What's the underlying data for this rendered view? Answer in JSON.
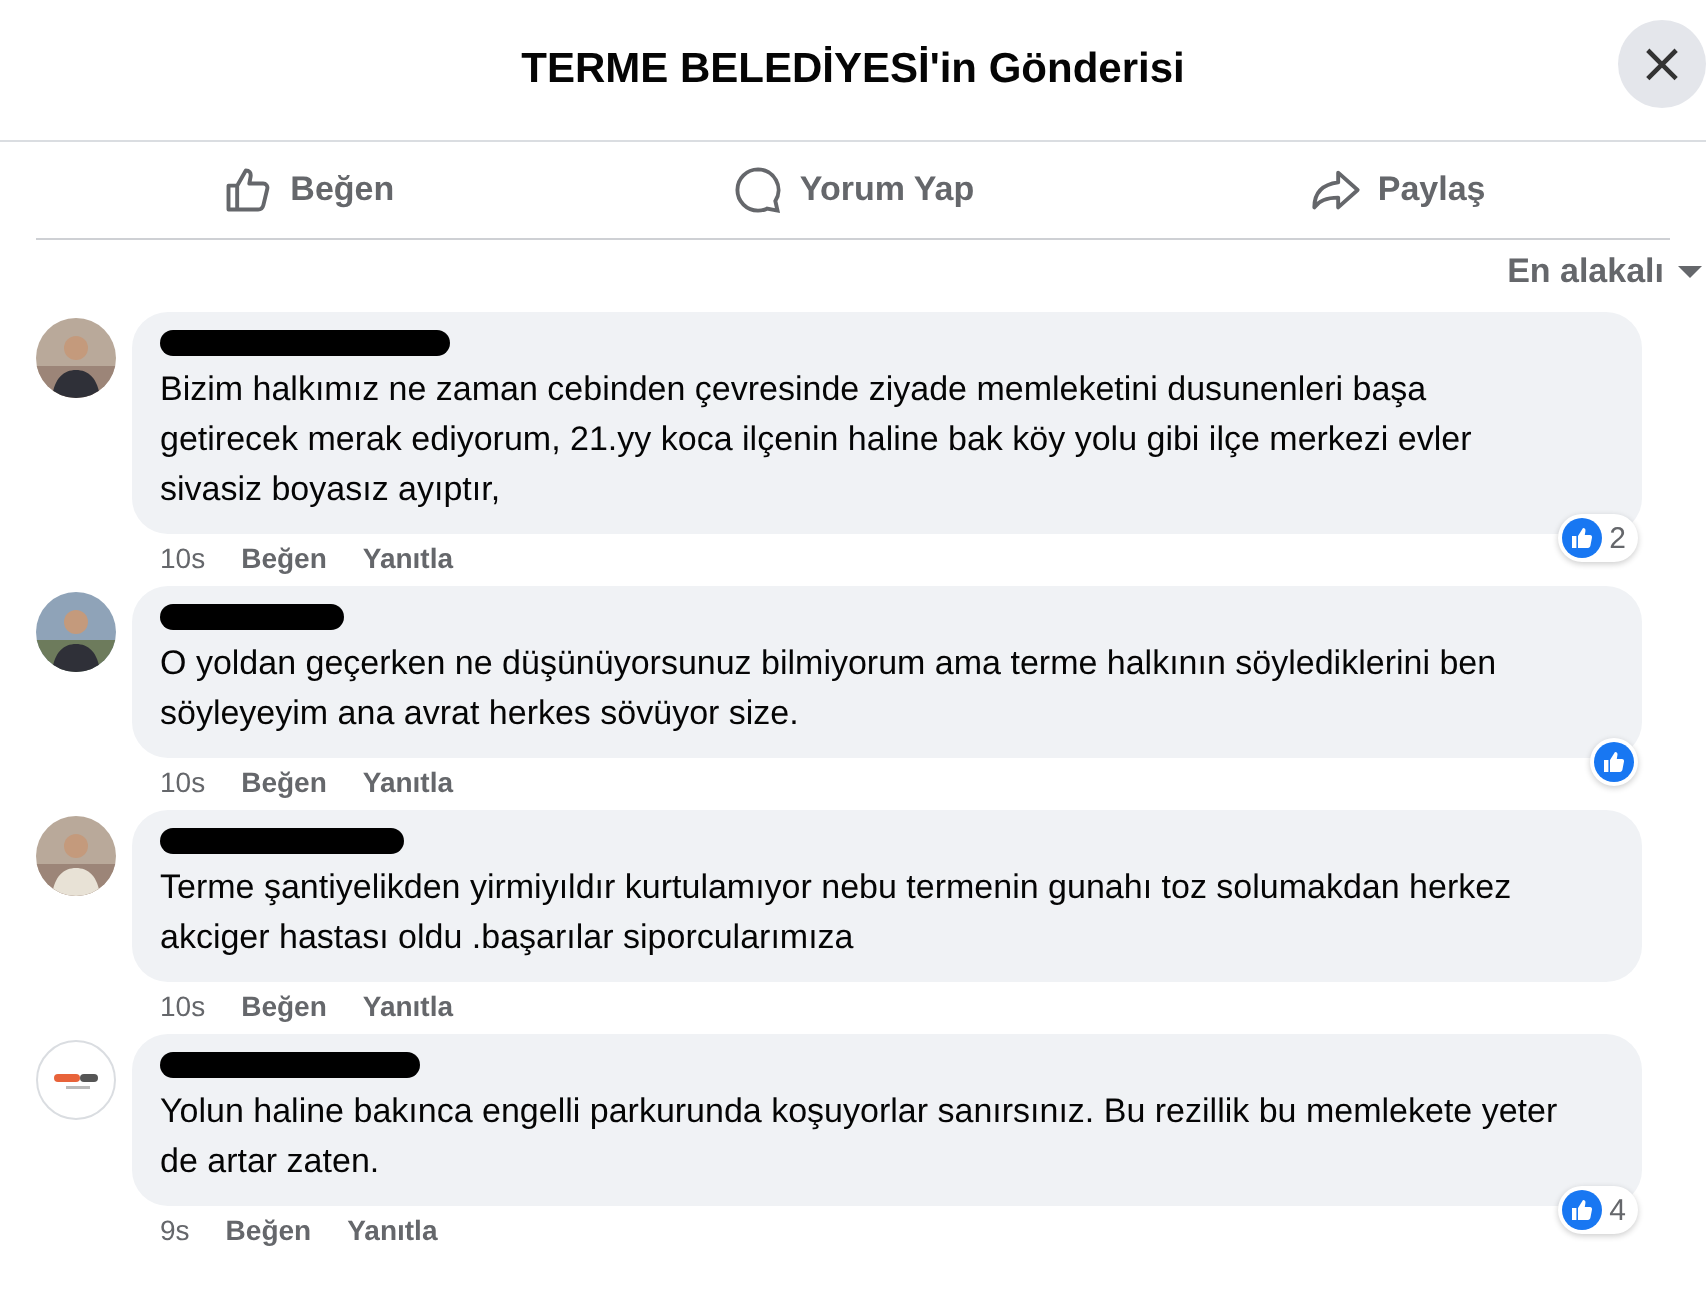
{
  "header": {
    "title": "TERME BELEDİYESİ'in Gönderisi",
    "close": "×"
  },
  "actions": [
    {
      "kind": "like",
      "label": "Beğen"
    },
    {
      "kind": "comment",
      "label": "Yorum Yap"
    },
    {
      "kind": "share",
      "label": "Paylaş"
    }
  ],
  "sort": {
    "label": "En alakalı"
  },
  "comments": [
    {
      "text": "Bizim halkımız ne zaman cebinden çevresinde ziyade memleketini dusunenleri başa getirecek merak ediyorum, 21.yy koca ilçenin haline bak köy yolu gibi ilçe merkezi evler sivasiz boyasız ayıptır,",
      "time": "10s",
      "like": "Beğen",
      "reply": "Yanıtla",
      "liked": true,
      "like_count": "2"
    },
    {
      "text": "O yoldan geçerken ne düşünüyorsunuz bilmiyorum ama terme halkının söylediklerini ben söyleyeyim ana avrat herkes sövüyor size.",
      "time": "10s",
      "like": "Beğen",
      "reply": "Yanıtla",
      "liked": true
    },
    {
      "text": "Terme şantiyelikden yirmiyıldır kurtulamıyor nebu termenin gunahı toz solumakdan herkez akciger hastası oldu .başarılar siporcularımıza",
      "time": "10s",
      "like": "Beğen",
      "reply": "Yanıtla",
      "liked": false
    },
    {
      "kind": "logo",
      "text": "Yolun haline bakınca engelli parkurunda koşuyorlar sanırsınız. Bu rezillik bu memlekete yeter de artar zaten.",
      "time": "9s",
      "like": "Beğen",
      "reply": "Yanıtla",
      "liked": true,
      "like_count": "4"
    }
  ]
}
